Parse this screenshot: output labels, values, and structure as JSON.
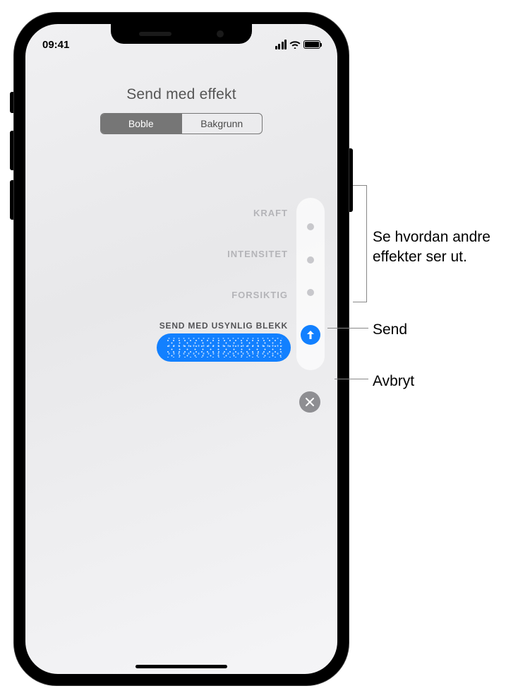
{
  "status": {
    "time": "09:41"
  },
  "header": {
    "title": "Send med effekt"
  },
  "segmented": {
    "active_label": "Boble",
    "inactive_label": "Bakgrunn"
  },
  "effects": {
    "kraft": "KRAFT",
    "intensitet": "INTENSITET",
    "forsiktig": "FORSIKTIG",
    "invisible": "SEND MED USYNLIG BLEKK"
  },
  "icons": {
    "send": "send-arrow-up-icon",
    "cancel": "close-x-icon"
  },
  "callouts": {
    "effects": "Se hvordan andre effekter ser ut.",
    "send": "Send",
    "cancel": "Avbryt"
  }
}
